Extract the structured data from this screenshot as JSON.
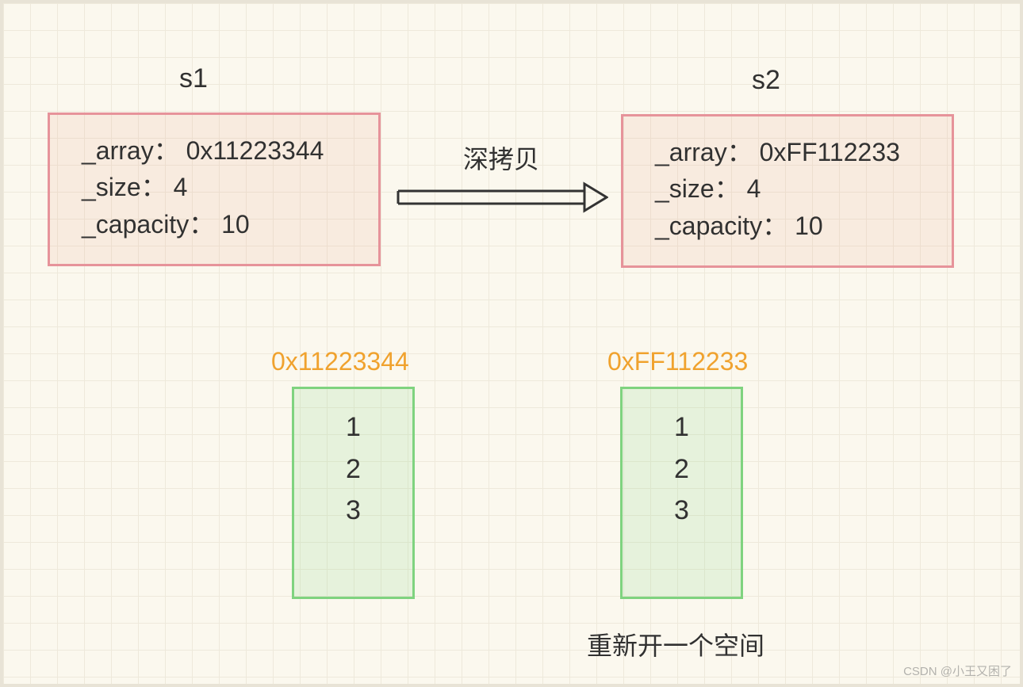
{
  "left": {
    "title": "s1",
    "array_label": "_array：",
    "array_value": "0x11223344",
    "size_label": "_size：",
    "size_value": "4",
    "capacity_label": "_capacity：",
    "capacity_value": "10"
  },
  "right": {
    "title": "s2",
    "array_label": "_array：",
    "array_value": "0xFF112233",
    "size_label": "_size：",
    "size_value": "4",
    "capacity_label": "_capacity：",
    "capacity_value": "10"
  },
  "arrow_label": "深拷贝",
  "memory": {
    "left": {
      "address": "0x11223344",
      "values": [
        "1",
        "2",
        "3"
      ]
    },
    "right": {
      "address": "0xFF112233",
      "values": [
        "1",
        "2",
        "3"
      ]
    }
  },
  "caption": "重新开一个空间",
  "watermark": "CSDN @小王又困了"
}
